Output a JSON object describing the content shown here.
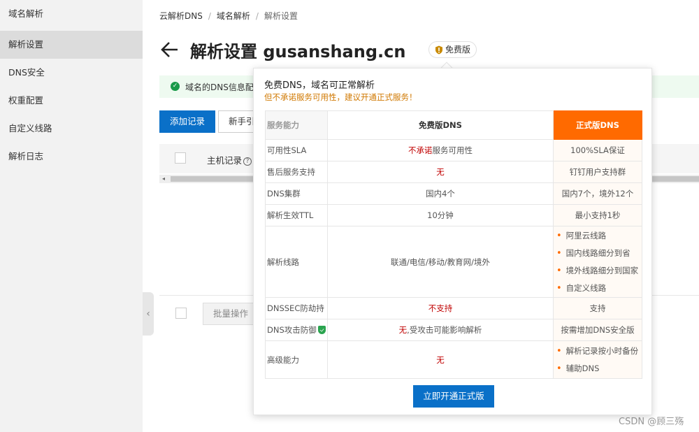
{
  "sidebar": {
    "items": [
      {
        "label": "域名解析"
      },
      {
        "label": "解析设置"
      },
      {
        "label": "DNS安全"
      },
      {
        "label": "权重配置"
      },
      {
        "label": "自定义线路"
      },
      {
        "label": "解析日志"
      }
    ],
    "active_index": 1
  },
  "breadcrumb": {
    "items": [
      "云解析DNS",
      "域名解析",
      "解析设置"
    ],
    "separator": "/"
  },
  "header": {
    "title": "解析设置 gusanshang.cn",
    "badge": "免费版"
  },
  "notice": {
    "text": "域名的DNS信息配"
  },
  "toolbar": {
    "add_record": "添加记录",
    "guide": "新手引"
  },
  "table": {
    "host_record_header": "主机记录",
    "help_glyph": "?"
  },
  "footer": {
    "batch_button": "批量操作"
  },
  "popover": {
    "title": "免费DNS，域名可正常解析",
    "subtitle": "但不承诺服务可用性，建议开通正式服务！",
    "headers": {
      "capability": "服务能力",
      "free": "免费版DNS",
      "pro": "正式版DNS"
    },
    "rows": [
      {
        "label": "可用性SLA",
        "free": "不承诺服务可用性",
        "free_red_part": "不承诺",
        "free_rest": "服务可用性",
        "pro": "100%SLA保证"
      },
      {
        "label": "售后服务支持",
        "free": "无",
        "pro": "钉钉用户支持群"
      },
      {
        "label": "DNS集群",
        "free": "国内4个",
        "pro": "国内7个，境外12个"
      },
      {
        "label": "解析生效TTL",
        "free": "10分钟",
        "pro": "最小支持1秒"
      },
      {
        "label": "解析线路",
        "free": "联通/电信/移动/教育网/境外",
        "pro_list": [
          "阿里云线路",
          "国内线路细分到省",
          "境外线路细分到国家",
          "自定义线路"
        ]
      },
      {
        "label": "DNSSEC防劫持",
        "free": "不支持",
        "pro": "支持"
      },
      {
        "label": "DNS攻击防御",
        "free_red_part": "无",
        "free_rest": ",受攻击可能影响解析",
        "pro": "按需增加DNS安全版"
      },
      {
        "label": "高级能力",
        "free": "无",
        "pro_list": [
          "解析记录按小时备份",
          "辅助DNS"
        ]
      }
    ],
    "cta": "立即开通正式版"
  },
  "watermark": "CSDN @顾三殇",
  "colors": {
    "primary": "#0a70c8",
    "pro_orange": "#ff6a00",
    "warning_red": "#c00000",
    "subtitle_orange": "#d07800",
    "success_green": "#1a9a4a"
  }
}
